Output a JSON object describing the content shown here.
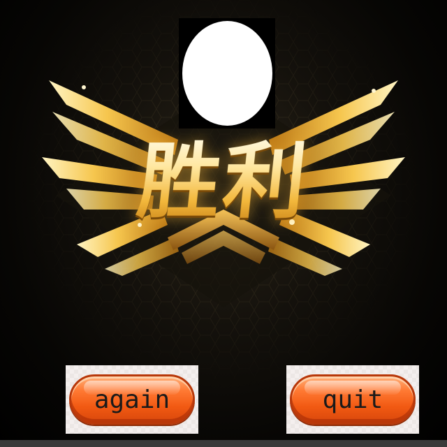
{
  "screen": {
    "victory_title": "胜利",
    "avatar": "player-avatar-placeholder"
  },
  "buttons": {
    "again_label": "again",
    "quit_label": "quit"
  },
  "colors": {
    "gold": "#f2b73b",
    "button_orange": "#f25a13",
    "background": "#000000"
  },
  "icons": {
    "emblem": "golden-wings-emblem"
  }
}
